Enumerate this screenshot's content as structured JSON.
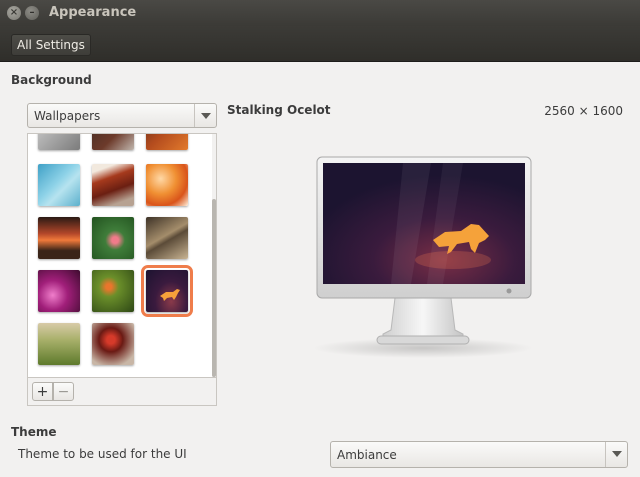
{
  "window": {
    "title": "Appearance",
    "close_glyph": "×",
    "min_glyph": "–"
  },
  "toolbar": {
    "all_settings_label": "All Settings"
  },
  "background": {
    "section_label": "Background",
    "source_select": {
      "value": "Wallpapers"
    },
    "selected_wallpaper": {
      "name": "Stalking Ocelot",
      "resolution": "2560 × 1600"
    },
    "thumbnails": [
      {
        "name": "partial-grey"
      },
      {
        "name": "partial-dark-road"
      },
      {
        "name": "partial-orange"
      },
      {
        "name": "blue-abstract"
      },
      {
        "name": "tree-lined-road"
      },
      {
        "name": "orange-leaves"
      },
      {
        "name": "sunset-landscape"
      },
      {
        "name": "pink-flowers"
      },
      {
        "name": "fountain-pen"
      },
      {
        "name": "magenta-bokeh"
      },
      {
        "name": "green-bokeh-flower"
      },
      {
        "name": "stalking-ocelot",
        "selected": true
      },
      {
        "name": "grass-field"
      },
      {
        "name": "red-berries"
      }
    ],
    "add_label": "+",
    "remove_label": "−"
  },
  "theme": {
    "section_label": "Theme",
    "description": "Theme to be used for the UI",
    "select": {
      "value": "Ambiance"
    }
  },
  "colors": {
    "accent": "#ef7d4b",
    "titlebar": "#3c3b37"
  }
}
